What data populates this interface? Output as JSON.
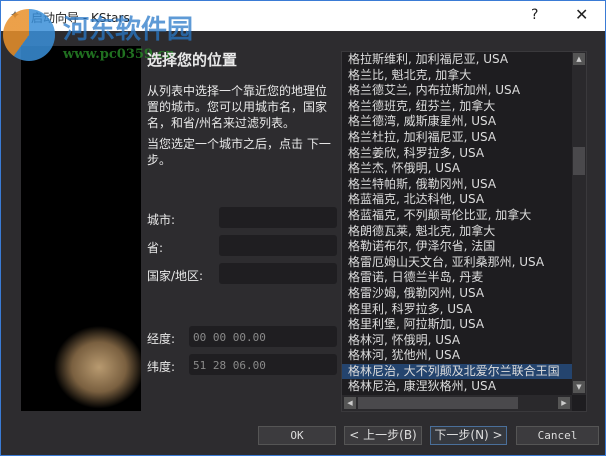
{
  "window": {
    "title": "启动向导 - KStars",
    "help": "?",
    "close": "✕"
  },
  "watermark": {
    "name": "河东软件园",
    "url": "www.pc0359.cn"
  },
  "page": {
    "heading": "选择您的位置",
    "desc": "从列表中选择一个靠近您的地理位置的城市。您可以用城市名，国家名，和省/州名来过滤列表。",
    "hint": "当您选定一个城市之后，点击 下一步。"
  },
  "filters": {
    "city_label": "城市:",
    "city": "",
    "province_label": "省:",
    "province": "",
    "country_label": "国家/地区:",
    "country": ""
  },
  "coords": {
    "longitude_label": "经度:",
    "longitude": "00 00 00.00",
    "latitude_label": "纬度:",
    "latitude": "51 28 06.00"
  },
  "cities": [
    "格拉斯维利, 加利福尼亚, USA",
    "格兰比, 魁北克, 加拿大",
    "格兰德艾兰, 内布拉斯加州, USA",
    "格兰德班克, 纽芬兰, 加拿大",
    "格兰德湾, 威斯康星州, USA",
    "格兰杜拉, 加利福尼亚, USA",
    "格兰姜欣, 科罗拉多, USA",
    "格兰杰, 怀俄明, USA",
    "格兰特帕斯, 俄勒冈州, USA",
    "格蓝福克, 北达科他, USA",
    "格蓝福克, 不列颠哥伦比亚, 加拿大",
    "格朗德瓦莱, 魁北克, 加拿大",
    "格勒诺布尔, 伊泽尔省, 法国",
    "格雷厄姆山天文台, 亚利桑那州, USA",
    "格雷诺, 日德兰半岛, 丹麦",
    "格雷沙姆, 俄勒冈州, USA",
    "格里利, 科罗拉多, USA",
    "格里利堡, 阿拉斯加, USA",
    "格林河, 怀俄明, USA",
    "格林河, 犹他州, USA",
    "格林尼治, 大不列颠及北爱尔兰联合王国",
    "格林尼治, 康涅狄格州, USA"
  ],
  "selected_index": 20,
  "buttons": {
    "ok": "OK",
    "back": "< 上一步(B)",
    "next": "下一步(N) >",
    "cancel": "Cancel"
  }
}
